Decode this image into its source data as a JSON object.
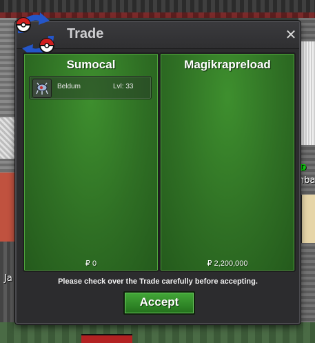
{
  "window": {
    "title": "Trade",
    "close_glyph": "✕"
  },
  "left_panel": {
    "player_name": "Sumocal",
    "pokemon": [
      {
        "name": "Beldum",
        "level": "Lvl: 33",
        "icon": "beldum-icon"
      }
    ],
    "money": "₽ 0"
  },
  "right_panel": {
    "player_name": "Magikrapreload",
    "pokemon": [],
    "money": "₽ 2,200,000"
  },
  "notice": "Please check over the Trade carefully before accepting.",
  "accept_label": "Accept",
  "background": {
    "left_text": "Ja",
    "right_text": "nba",
    "right_green": "D"
  },
  "colors": {
    "panel_green": "#2f6f24",
    "accept_green": "#43a838",
    "window_bg": "#2c2c2e"
  }
}
